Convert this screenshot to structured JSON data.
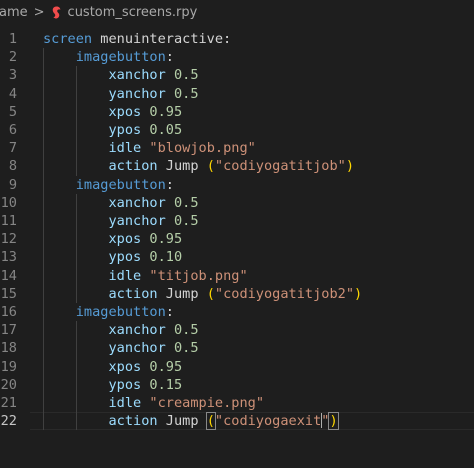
{
  "breadcrumb": {
    "parent": "ame",
    "separator": ">",
    "file_name": "custom_screens.rpy"
  },
  "colors": {
    "background": "#1e1e1e",
    "keyword": "#569cd6",
    "property": "#9cdcfe",
    "number": "#b5cea8",
    "string": "#ce9178",
    "bracket": "#ffd700",
    "line_number": "#858585",
    "file_icon": "#f14c4c"
  },
  "editor": {
    "current_line": 22,
    "lines": [
      {
        "n": "1",
        "tokens": [
          {
            "t": "kw",
            "v": "screen"
          },
          {
            "t": "id",
            "v": " menuinteractive:"
          }
        ]
      },
      {
        "n": "2",
        "tokens": [
          {
            "t": "ws",
            "v": "    "
          },
          {
            "t": "kw",
            "v": "imagebutton"
          },
          {
            "t": "id",
            "v": ":"
          }
        ]
      },
      {
        "n": "3",
        "tokens": [
          {
            "t": "ws",
            "v": "        "
          },
          {
            "t": "prop",
            "v": "xanchor"
          },
          {
            "t": "id",
            "v": " "
          },
          {
            "t": "num",
            "v": "0.5"
          }
        ]
      },
      {
        "n": "4",
        "tokens": [
          {
            "t": "ws",
            "v": "        "
          },
          {
            "t": "prop",
            "v": "yanchor"
          },
          {
            "t": "id",
            "v": " "
          },
          {
            "t": "num",
            "v": "0.5"
          }
        ]
      },
      {
        "n": "5",
        "tokens": [
          {
            "t": "ws",
            "v": "        "
          },
          {
            "t": "prop",
            "v": "xpos"
          },
          {
            "t": "id",
            "v": " "
          },
          {
            "t": "num",
            "v": "0.95"
          }
        ]
      },
      {
        "n": "6",
        "tokens": [
          {
            "t": "ws",
            "v": "        "
          },
          {
            "t": "prop",
            "v": "ypos"
          },
          {
            "t": "id",
            "v": " "
          },
          {
            "t": "num",
            "v": "0.05"
          }
        ]
      },
      {
        "n": "7",
        "tokens": [
          {
            "t": "ws",
            "v": "        "
          },
          {
            "t": "prop",
            "v": "idle"
          },
          {
            "t": "id",
            "v": " "
          },
          {
            "t": "str",
            "v": "\"blowjob.png\""
          }
        ]
      },
      {
        "n": "8",
        "tokens": [
          {
            "t": "ws",
            "v": "        "
          },
          {
            "t": "prop",
            "v": "action"
          },
          {
            "t": "id",
            "v": " Jump "
          },
          {
            "t": "paren",
            "v": "("
          },
          {
            "t": "str",
            "v": "\"codiyogatitjob\""
          },
          {
            "t": "paren",
            "v": ")"
          }
        ]
      },
      {
        "n": "9",
        "tokens": [
          {
            "t": "ws",
            "v": "    "
          },
          {
            "t": "kw",
            "v": "imagebutton"
          },
          {
            "t": "id",
            "v": ":"
          }
        ]
      },
      {
        "n": "10",
        "tokens": [
          {
            "t": "ws",
            "v": "        "
          },
          {
            "t": "prop",
            "v": "xanchor"
          },
          {
            "t": "id",
            "v": " "
          },
          {
            "t": "num",
            "v": "0.5"
          }
        ]
      },
      {
        "n": "11",
        "tokens": [
          {
            "t": "ws",
            "v": "        "
          },
          {
            "t": "prop",
            "v": "yanchor"
          },
          {
            "t": "id",
            "v": " "
          },
          {
            "t": "num",
            "v": "0.5"
          }
        ]
      },
      {
        "n": "12",
        "tokens": [
          {
            "t": "ws",
            "v": "        "
          },
          {
            "t": "prop",
            "v": "xpos"
          },
          {
            "t": "id",
            "v": " "
          },
          {
            "t": "num",
            "v": "0.95"
          }
        ]
      },
      {
        "n": "13",
        "tokens": [
          {
            "t": "ws",
            "v": "        "
          },
          {
            "t": "prop",
            "v": "ypos"
          },
          {
            "t": "id",
            "v": " "
          },
          {
            "t": "num",
            "v": "0.10"
          }
        ]
      },
      {
        "n": "14",
        "tokens": [
          {
            "t": "ws",
            "v": "        "
          },
          {
            "t": "prop",
            "v": "idle"
          },
          {
            "t": "id",
            "v": " "
          },
          {
            "t": "str",
            "v": "\"titjob.png\""
          }
        ]
      },
      {
        "n": "15",
        "tokens": [
          {
            "t": "ws",
            "v": "        "
          },
          {
            "t": "prop",
            "v": "action"
          },
          {
            "t": "id",
            "v": " Jump "
          },
          {
            "t": "paren",
            "v": "("
          },
          {
            "t": "str",
            "v": "\"codiyogatitjob2\""
          },
          {
            "t": "paren",
            "v": ")"
          }
        ]
      },
      {
        "n": "16",
        "tokens": [
          {
            "t": "ws",
            "v": "    "
          },
          {
            "t": "kw",
            "v": "imagebutton"
          },
          {
            "t": "id",
            "v": ":"
          }
        ]
      },
      {
        "n": "17",
        "tokens": [
          {
            "t": "ws",
            "v": "        "
          },
          {
            "t": "prop",
            "v": "xanchor"
          },
          {
            "t": "id",
            "v": " "
          },
          {
            "t": "num",
            "v": "0.5"
          }
        ]
      },
      {
        "n": "18",
        "tokens": [
          {
            "t": "ws",
            "v": "        "
          },
          {
            "t": "prop",
            "v": "yanchor"
          },
          {
            "t": "id",
            "v": " "
          },
          {
            "t": "num",
            "v": "0.5"
          }
        ]
      },
      {
        "n": "19",
        "tokens": [
          {
            "t": "ws",
            "v": "        "
          },
          {
            "t": "prop",
            "v": "xpos"
          },
          {
            "t": "id",
            "v": " "
          },
          {
            "t": "num",
            "v": "0.95"
          }
        ]
      },
      {
        "n": "20",
        "tokens": [
          {
            "t": "ws",
            "v": "        "
          },
          {
            "t": "prop",
            "v": "ypos"
          },
          {
            "t": "id",
            "v": " "
          },
          {
            "t": "num",
            "v": "0.15"
          }
        ]
      },
      {
        "n": "21",
        "tokens": [
          {
            "t": "ws",
            "v": "        "
          },
          {
            "t": "prop",
            "v": "idle"
          },
          {
            "t": "id",
            "v": " "
          },
          {
            "t": "str",
            "v": "\"creampie.png\""
          }
        ]
      },
      {
        "n": "22",
        "tokens": [
          {
            "t": "ws",
            "v": "        "
          },
          {
            "t": "prop",
            "v": "action"
          },
          {
            "t": "id",
            "v": " Jump "
          },
          {
            "t": "parenm",
            "v": "("
          },
          {
            "t": "str",
            "v": "\"codiyogaexit"
          },
          {
            "t": "caret",
            "v": ""
          },
          {
            "t": "str",
            "v": "\""
          },
          {
            "t": "parenm",
            "v": ")"
          }
        ]
      }
    ]
  }
}
